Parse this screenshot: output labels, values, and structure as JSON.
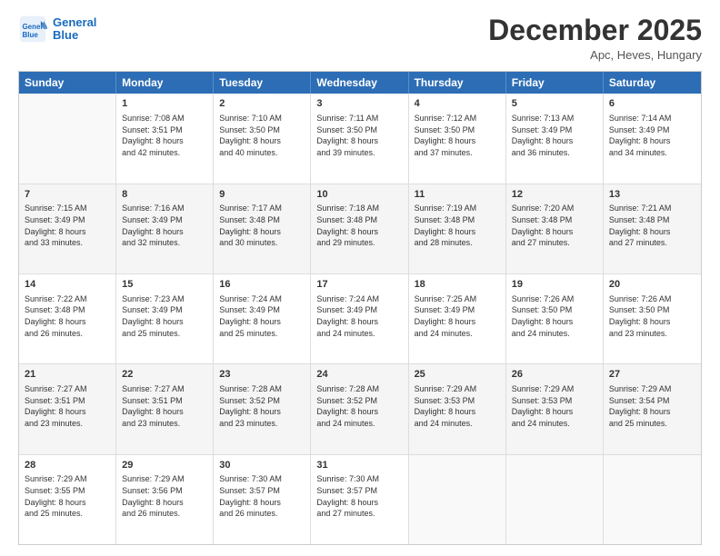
{
  "header": {
    "logo_line1": "General",
    "logo_line2": "Blue",
    "month": "December 2025",
    "location": "Apc, Heves, Hungary"
  },
  "days_of_week": [
    "Sunday",
    "Monday",
    "Tuesday",
    "Wednesday",
    "Thursday",
    "Friday",
    "Saturday"
  ],
  "weeks": [
    [
      {
        "day": "",
        "info": ""
      },
      {
        "day": "1",
        "info": "Sunrise: 7:08 AM\nSunset: 3:51 PM\nDaylight: 8 hours\nand 42 minutes."
      },
      {
        "day": "2",
        "info": "Sunrise: 7:10 AM\nSunset: 3:50 PM\nDaylight: 8 hours\nand 40 minutes."
      },
      {
        "day": "3",
        "info": "Sunrise: 7:11 AM\nSunset: 3:50 PM\nDaylight: 8 hours\nand 39 minutes."
      },
      {
        "day": "4",
        "info": "Sunrise: 7:12 AM\nSunset: 3:50 PM\nDaylight: 8 hours\nand 37 minutes."
      },
      {
        "day": "5",
        "info": "Sunrise: 7:13 AM\nSunset: 3:49 PM\nDaylight: 8 hours\nand 36 minutes."
      },
      {
        "day": "6",
        "info": "Sunrise: 7:14 AM\nSunset: 3:49 PM\nDaylight: 8 hours\nand 34 minutes."
      }
    ],
    [
      {
        "day": "7",
        "info": "Sunrise: 7:15 AM\nSunset: 3:49 PM\nDaylight: 8 hours\nand 33 minutes."
      },
      {
        "day": "8",
        "info": "Sunrise: 7:16 AM\nSunset: 3:49 PM\nDaylight: 8 hours\nand 32 minutes."
      },
      {
        "day": "9",
        "info": "Sunrise: 7:17 AM\nSunset: 3:48 PM\nDaylight: 8 hours\nand 30 minutes."
      },
      {
        "day": "10",
        "info": "Sunrise: 7:18 AM\nSunset: 3:48 PM\nDaylight: 8 hours\nand 29 minutes."
      },
      {
        "day": "11",
        "info": "Sunrise: 7:19 AM\nSunset: 3:48 PM\nDaylight: 8 hours\nand 28 minutes."
      },
      {
        "day": "12",
        "info": "Sunrise: 7:20 AM\nSunset: 3:48 PM\nDaylight: 8 hours\nand 27 minutes."
      },
      {
        "day": "13",
        "info": "Sunrise: 7:21 AM\nSunset: 3:48 PM\nDaylight: 8 hours\nand 27 minutes."
      }
    ],
    [
      {
        "day": "14",
        "info": "Sunrise: 7:22 AM\nSunset: 3:48 PM\nDaylight: 8 hours\nand 26 minutes."
      },
      {
        "day": "15",
        "info": "Sunrise: 7:23 AM\nSunset: 3:49 PM\nDaylight: 8 hours\nand 25 minutes."
      },
      {
        "day": "16",
        "info": "Sunrise: 7:24 AM\nSunset: 3:49 PM\nDaylight: 8 hours\nand 25 minutes."
      },
      {
        "day": "17",
        "info": "Sunrise: 7:24 AM\nSunset: 3:49 PM\nDaylight: 8 hours\nand 24 minutes."
      },
      {
        "day": "18",
        "info": "Sunrise: 7:25 AM\nSunset: 3:49 PM\nDaylight: 8 hours\nand 24 minutes."
      },
      {
        "day": "19",
        "info": "Sunrise: 7:26 AM\nSunset: 3:50 PM\nDaylight: 8 hours\nand 24 minutes."
      },
      {
        "day": "20",
        "info": "Sunrise: 7:26 AM\nSunset: 3:50 PM\nDaylight: 8 hours\nand 23 minutes."
      }
    ],
    [
      {
        "day": "21",
        "info": "Sunrise: 7:27 AM\nSunset: 3:51 PM\nDaylight: 8 hours\nand 23 minutes."
      },
      {
        "day": "22",
        "info": "Sunrise: 7:27 AM\nSunset: 3:51 PM\nDaylight: 8 hours\nand 23 minutes."
      },
      {
        "day": "23",
        "info": "Sunrise: 7:28 AM\nSunset: 3:52 PM\nDaylight: 8 hours\nand 23 minutes."
      },
      {
        "day": "24",
        "info": "Sunrise: 7:28 AM\nSunset: 3:52 PM\nDaylight: 8 hours\nand 24 minutes."
      },
      {
        "day": "25",
        "info": "Sunrise: 7:29 AM\nSunset: 3:53 PM\nDaylight: 8 hours\nand 24 minutes."
      },
      {
        "day": "26",
        "info": "Sunrise: 7:29 AM\nSunset: 3:53 PM\nDaylight: 8 hours\nand 24 minutes."
      },
      {
        "day": "27",
        "info": "Sunrise: 7:29 AM\nSunset: 3:54 PM\nDaylight: 8 hours\nand 25 minutes."
      }
    ],
    [
      {
        "day": "28",
        "info": "Sunrise: 7:29 AM\nSunset: 3:55 PM\nDaylight: 8 hours\nand 25 minutes."
      },
      {
        "day": "29",
        "info": "Sunrise: 7:29 AM\nSunset: 3:56 PM\nDaylight: 8 hours\nand 26 minutes."
      },
      {
        "day": "30",
        "info": "Sunrise: 7:30 AM\nSunset: 3:57 PM\nDaylight: 8 hours\nand 26 minutes."
      },
      {
        "day": "31",
        "info": "Sunrise: 7:30 AM\nSunset: 3:57 PM\nDaylight: 8 hours\nand 27 minutes."
      },
      {
        "day": "",
        "info": ""
      },
      {
        "day": "",
        "info": ""
      },
      {
        "day": "",
        "info": ""
      }
    ]
  ]
}
